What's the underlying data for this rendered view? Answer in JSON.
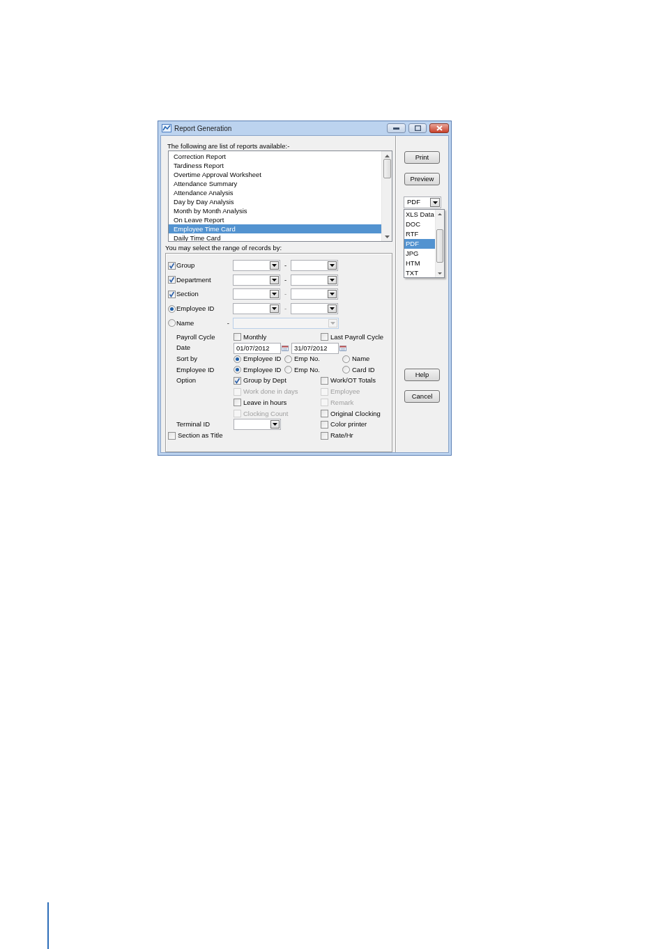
{
  "window": {
    "title": "Report Generation"
  },
  "reports": {
    "label": "The following are list of reports available:-",
    "items": [
      {
        "label": "Correction Report",
        "selected": false
      },
      {
        "label": "Tardiness Report",
        "selected": false
      },
      {
        "label": "Overtime Approval Worksheet",
        "selected": false
      },
      {
        "label": "Attendance Summary",
        "selected": false
      },
      {
        "label": "Attendance Analysis",
        "selected": false
      },
      {
        "label": "Day by Day Analysis",
        "selected": false
      },
      {
        "label": "Month by Month Analysis",
        "selected": false
      },
      {
        "label": "On Leave Report",
        "selected": false
      },
      {
        "label": "Employee Time Card",
        "selected": true
      },
      {
        "label": "Daily Time Card",
        "selected": false
      }
    ]
  },
  "range": {
    "label": "You may select the range of records by:",
    "rows": [
      {
        "kind": "checkbox",
        "label": "Group",
        "checked": true,
        "separator": "-",
        "paired": true,
        "disabled": false
      },
      {
        "kind": "checkbox",
        "label": "Department",
        "checked": true,
        "separator": "-",
        "paired": true,
        "disabled": false
      },
      {
        "kind": "checkbox",
        "label": "Section",
        "checked": true,
        "separator": "-",
        "paired": true,
        "disabled": false
      },
      {
        "kind": "radio",
        "label": "Employee ID",
        "selected": true,
        "separator": "-",
        "paired": true,
        "disabled": false
      },
      {
        "kind": "radio",
        "label": "Name",
        "selected": false,
        "separator": "-",
        "paired": false,
        "disabled": true
      }
    ]
  },
  "payroll_cycle": {
    "label": "Payroll Cycle",
    "options": [
      {
        "label": "Monthly",
        "checked": false
      },
      {
        "label": "Last Payroll Cycle",
        "checked": false
      }
    ]
  },
  "date": {
    "label": "Date",
    "from": "01/07/2012",
    "to": "31/07/2012"
  },
  "sort_by": {
    "label": "Sort by",
    "options": [
      {
        "label": "Employee ID",
        "selected": true
      },
      {
        "label": "Emp No.",
        "selected": false
      },
      {
        "label": "Name",
        "selected": false
      }
    ]
  },
  "employee_id": {
    "label": "Employee ID",
    "options": [
      {
        "label": "Employee ID",
        "selected": true
      },
      {
        "label": "Emp No.",
        "selected": false
      },
      {
        "label": "Card ID",
        "selected": false
      }
    ]
  },
  "option": {
    "label": "Option",
    "left": [
      {
        "label": "Group by Dept",
        "checked": true,
        "disabled": false
      },
      {
        "label": "Work done in days",
        "checked": false,
        "disabled": true
      },
      {
        "label": "Leave in hours",
        "checked": false,
        "disabled": false
      },
      {
        "label": "Clocking Count",
        "checked": false,
        "disabled": true
      }
    ],
    "right": [
      {
        "label": "Work/OT Totals",
        "checked": false,
        "disabled": false
      },
      {
        "label": "Employee",
        "checked": false,
        "disabled": true
      },
      {
        "label": "Remark",
        "checked": false,
        "disabled": true
      },
      {
        "label": "Original Clocking",
        "checked": false,
        "disabled": false
      },
      {
        "label": "Color printer",
        "checked": false,
        "disabled": false
      },
      {
        "label": "Rate/Hr",
        "checked": false,
        "disabled": false
      }
    ]
  },
  "terminal_id": {
    "label": "Terminal ID"
  },
  "section_as_title": {
    "label": "Section as Title",
    "checked": false
  },
  "buttons_top": [
    "Print",
    "Preview"
  ],
  "format": {
    "value": "PDF",
    "options": [
      {
        "label": "XLS Data",
        "selected": false
      },
      {
        "label": "DOC",
        "selected": false
      },
      {
        "label": "RTF",
        "selected": false
      },
      {
        "label": "PDF",
        "selected": true
      },
      {
        "label": "JPG",
        "selected": false
      },
      {
        "label": "HTM",
        "selected": false
      },
      {
        "label": "TXT",
        "selected": false
      }
    ]
  },
  "buttons_bottom": [
    "Help",
    "Cancel"
  ]
}
